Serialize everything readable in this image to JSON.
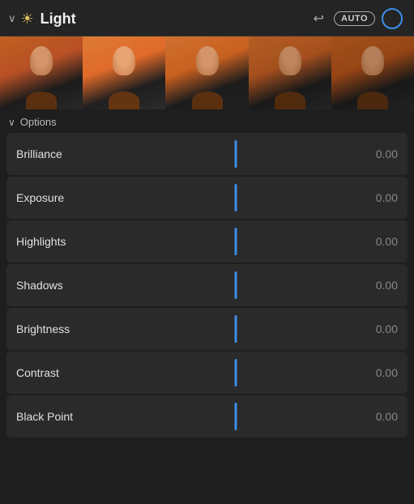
{
  "header": {
    "title": "Light",
    "auto_label": "AUTO",
    "undo_icon": "↩",
    "chevron": "∨"
  },
  "thumbnails": [
    {
      "id": 1,
      "selected": false
    },
    {
      "id": 2,
      "selected": false
    },
    {
      "id": 3,
      "selected": true
    },
    {
      "id": 4,
      "selected": false
    },
    {
      "id": 5,
      "selected": false
    }
  ],
  "options": {
    "label": "Options",
    "chevron": "∨"
  },
  "sliders": [
    {
      "id": "brilliance",
      "label": "Brilliance",
      "value": "0.00"
    },
    {
      "id": "exposure",
      "label": "Exposure",
      "value": "0.00"
    },
    {
      "id": "highlights",
      "label": "Highlights",
      "value": "0.00"
    },
    {
      "id": "shadows",
      "label": "Shadows",
      "value": "0.00"
    },
    {
      "id": "brightness",
      "label": "Brightness",
      "value": "0.00"
    },
    {
      "id": "contrast",
      "label": "Contrast",
      "value": "0.00"
    },
    {
      "id": "black-point",
      "label": "Black Point",
      "value": "0.00"
    }
  ],
  "colors": {
    "accent": "#3b8fe8",
    "bg_primary": "#1e1e1e",
    "bg_row": "#2a2a2a",
    "text_primary": "#e0e0e0",
    "text_secondary": "#888"
  }
}
